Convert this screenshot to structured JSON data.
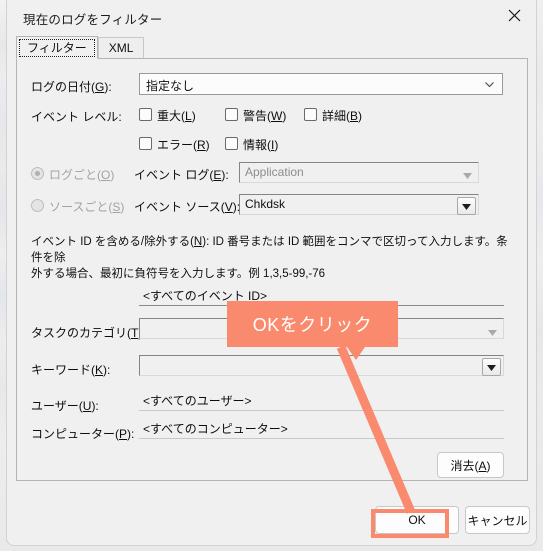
{
  "window": {
    "title": "現在のログをフィルター",
    "close_icon": "close-icon"
  },
  "tabs": [
    {
      "label": "フィルター",
      "active": true
    },
    {
      "label": "XML",
      "active": false
    }
  ],
  "form": {
    "logged": {
      "label": "ログの日付(G):",
      "value": "指定なし",
      "chevron_icon": "chevron-down-icon"
    },
    "event_level": {
      "label": "イベント レベル:",
      "options": [
        {
          "label": "重大(L)",
          "checked": false
        },
        {
          "label": "警告(W)",
          "checked": false
        },
        {
          "label": "詳細(B)",
          "checked": false
        },
        {
          "label": "エラー(R)",
          "checked": false
        },
        {
          "label": "情報(I)",
          "checked": false
        }
      ]
    },
    "by_log_radio": {
      "label": "ログごと(O)",
      "selected": true,
      "enabled": false
    },
    "by_source_radio": {
      "label": "ソースごと(S)",
      "selected": false,
      "enabled": false
    },
    "event_logs": {
      "label": "イベント ログ(E):",
      "value": "Application",
      "enabled": false
    },
    "event_sources": {
      "label": "イベント ソース(V):",
      "value": "Chkdsk",
      "enabled": true
    },
    "event_ids": {
      "help_line1": "イベント ID を含める/除外する(N): ID 番号または ID 範囲をコンマで区切って入力します。条件を除",
      "help_line2": "外する場合、最初に負符号を入力します。例 1,3,5-99,-76",
      "value": "<すべてのイベント ID>"
    },
    "task_category": {
      "label": "タスクのカテゴリ(T):",
      "value": ""
    },
    "keywords": {
      "label": "キーワード(K):",
      "value": ""
    },
    "user": {
      "label": "ユーザー(U):",
      "value": "<すべてのユーザー>"
    },
    "computer": {
      "label": "コンピューター(P):",
      "value": "<すべてのコンピューター>"
    },
    "clear_button": "消去(A)"
  },
  "footer": {
    "ok_button": "OK",
    "cancel_button": "キャンセル"
  },
  "annotation": {
    "callout_text": "OKをクリック",
    "color": "#fa8a6e"
  }
}
